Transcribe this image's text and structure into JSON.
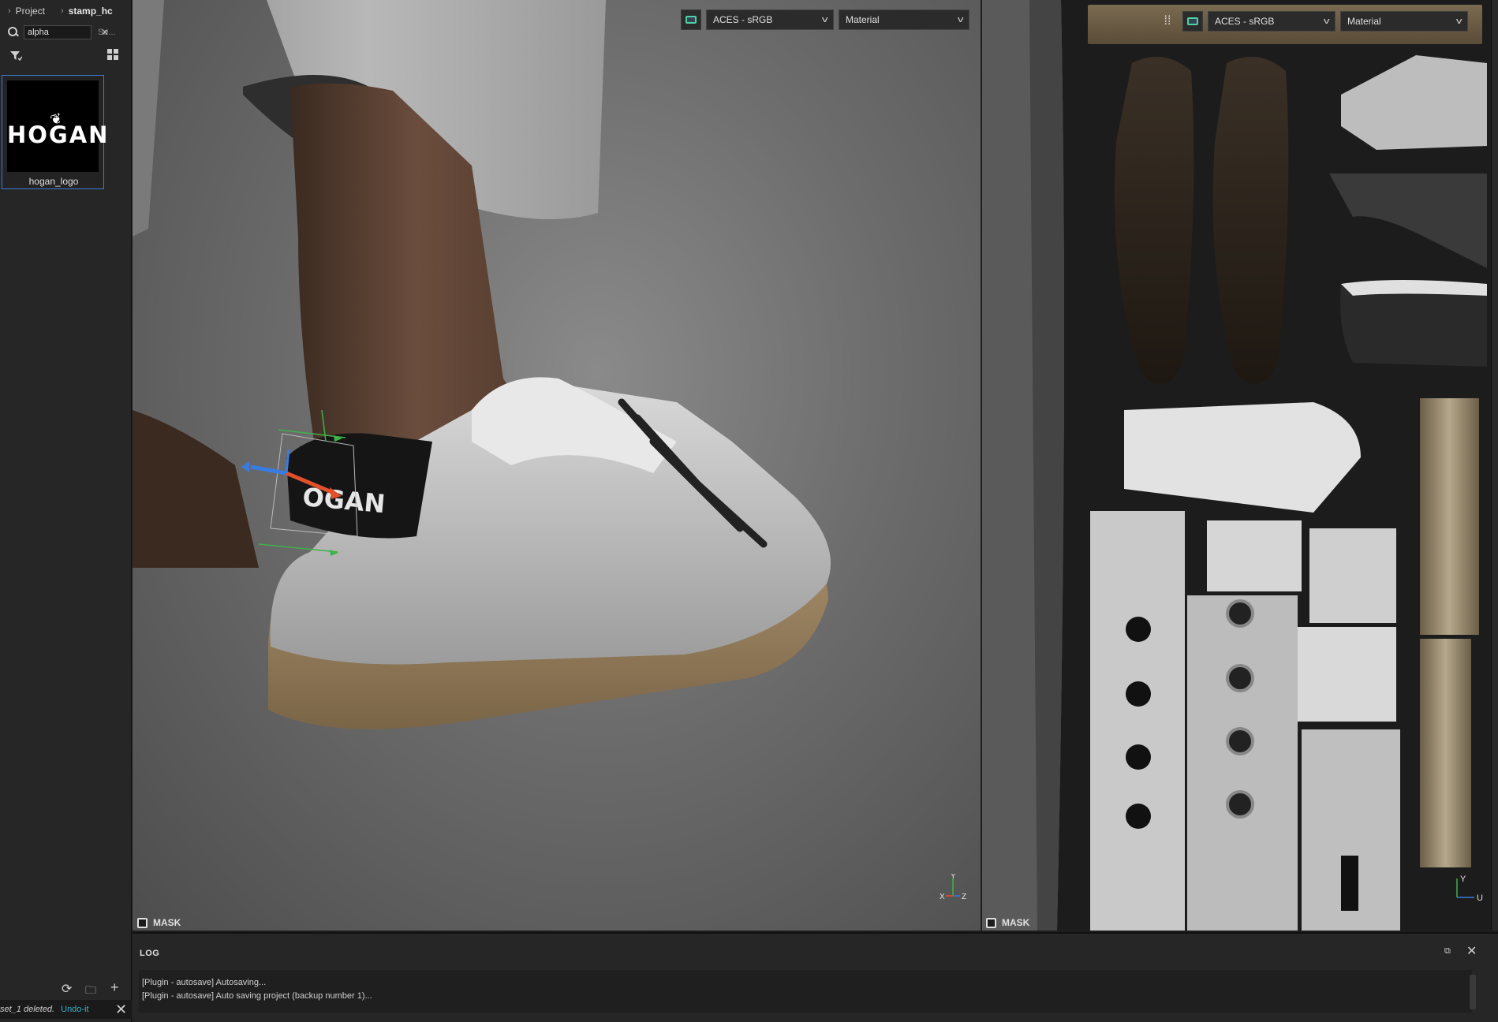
{
  "left_panel": {
    "breadcrumb": [
      "Project",
      "stamp_hc"
    ],
    "search": {
      "value": "alpha",
      "hint": "Se..."
    },
    "asset": {
      "name": "hogan_logo",
      "logo_text": "HOGAN"
    }
  },
  "status": {
    "message": "set_1 deleted.",
    "undo": "Undo-it"
  },
  "viewport3d": {
    "colorspace": "ACES - sRGB",
    "channel": "Material",
    "mask_label": "MASK",
    "decal_text": "OGAN",
    "axes": {
      "x": "X",
      "y": "Y",
      "z": "Z"
    }
  },
  "viewport2d": {
    "colorspace": "ACES - sRGB",
    "channel": "Material",
    "mask_label": "MASK",
    "axes": {
      "u": "U",
      "v": "Y"
    }
  },
  "log": {
    "title": "LOG",
    "lines": [
      "[Plugin - autosave] Autosaving...",
      "[Plugin - autosave] Auto saving project (backup number 1)..."
    ]
  },
  "colors": {
    "accent": "#3e7bd6",
    "link": "#3bb0c9",
    "gizmo_x": "#e0502a",
    "gizmo_y": "#3fb24a",
    "gizmo_z": "#3a7be0"
  }
}
